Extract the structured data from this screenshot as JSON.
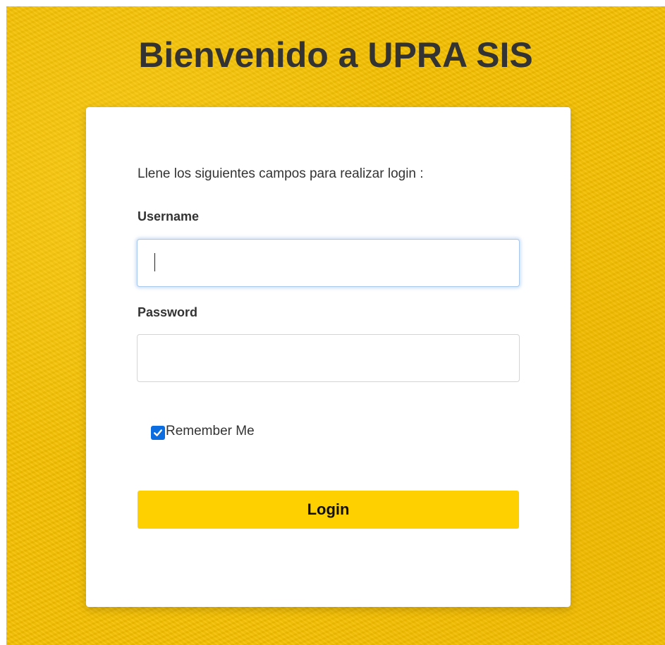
{
  "page": {
    "title": "Bienvenido a UPRA SIS",
    "background_color": "#f5c000"
  },
  "login_card": {
    "instructions": "Llene los siguientes campos para realizar login :",
    "username": {
      "label": "Username",
      "value": "",
      "focused": true
    },
    "password": {
      "label": "Password",
      "value": ""
    },
    "remember_me": {
      "label": "Remember Me",
      "checked": true,
      "accent_color": "#0b6de0"
    },
    "submit": {
      "label": "Login",
      "color": "#ffd000"
    }
  }
}
